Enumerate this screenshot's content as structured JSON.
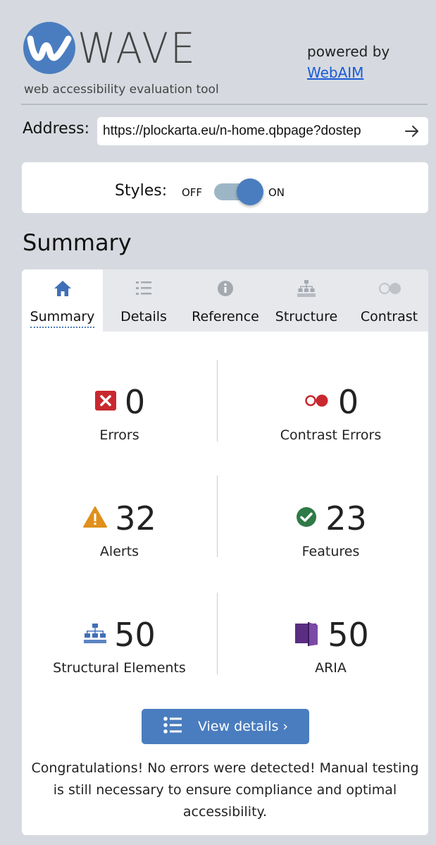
{
  "header": {
    "logo_text": "WAVE",
    "tagline": "web accessibility evaluation tool",
    "powered_by": "powered by",
    "webaim_link": "WebAIM"
  },
  "address": {
    "label": "Address:",
    "value": "https://plockarta.eu/n-home.qbpage?dostep",
    "go_icon": "arrow-right-icon"
  },
  "styles_toggle": {
    "label": "Styles:",
    "off_label": "OFF",
    "on_label": "ON",
    "state": "on"
  },
  "summary_heading": "Summary",
  "tabs": [
    {
      "label": "Summary",
      "icon": "home-icon",
      "active": true
    },
    {
      "label": "Details",
      "icon": "list-icon",
      "active": false
    },
    {
      "label": "Reference",
      "icon": "info-icon",
      "active": false
    },
    {
      "label": "Structure",
      "icon": "structure-icon",
      "active": false
    },
    {
      "label": "Contrast",
      "icon": "contrast-icon",
      "active": false
    }
  ],
  "stats": {
    "errors": {
      "count": "0",
      "label": "Errors",
      "icon": "error-icon",
      "color": "#c8282f"
    },
    "contrast_errors": {
      "count": "0",
      "label": "Contrast Errors",
      "icon": "contrast-error-icon",
      "color": "#c8282f"
    },
    "alerts": {
      "count": "32",
      "label": "Alerts",
      "icon": "alert-icon",
      "color": "#e0901b"
    },
    "features": {
      "count": "23",
      "label": "Features",
      "icon": "feature-check-icon",
      "color": "#2f7a47"
    },
    "structural": {
      "count": "50",
      "label": "Structural Elements",
      "icon": "structure-icon",
      "color": "#3f6fb7"
    },
    "aria": {
      "count": "50",
      "label": "ARIA",
      "icon": "aria-icon",
      "color": "#5a2d82"
    }
  },
  "view_details": {
    "label": "View details ›",
    "icon": "list-icon"
  },
  "congrats_text": "Congratulations! No errors were detected! Manual testing is still necessary to ensure compliance and optimal accessibility.",
  "colors": {
    "brand_blue": "#4a7dbf",
    "link": "#1a5bd6",
    "background": "#d6dae0",
    "tabbar": "#e6e8eb"
  }
}
